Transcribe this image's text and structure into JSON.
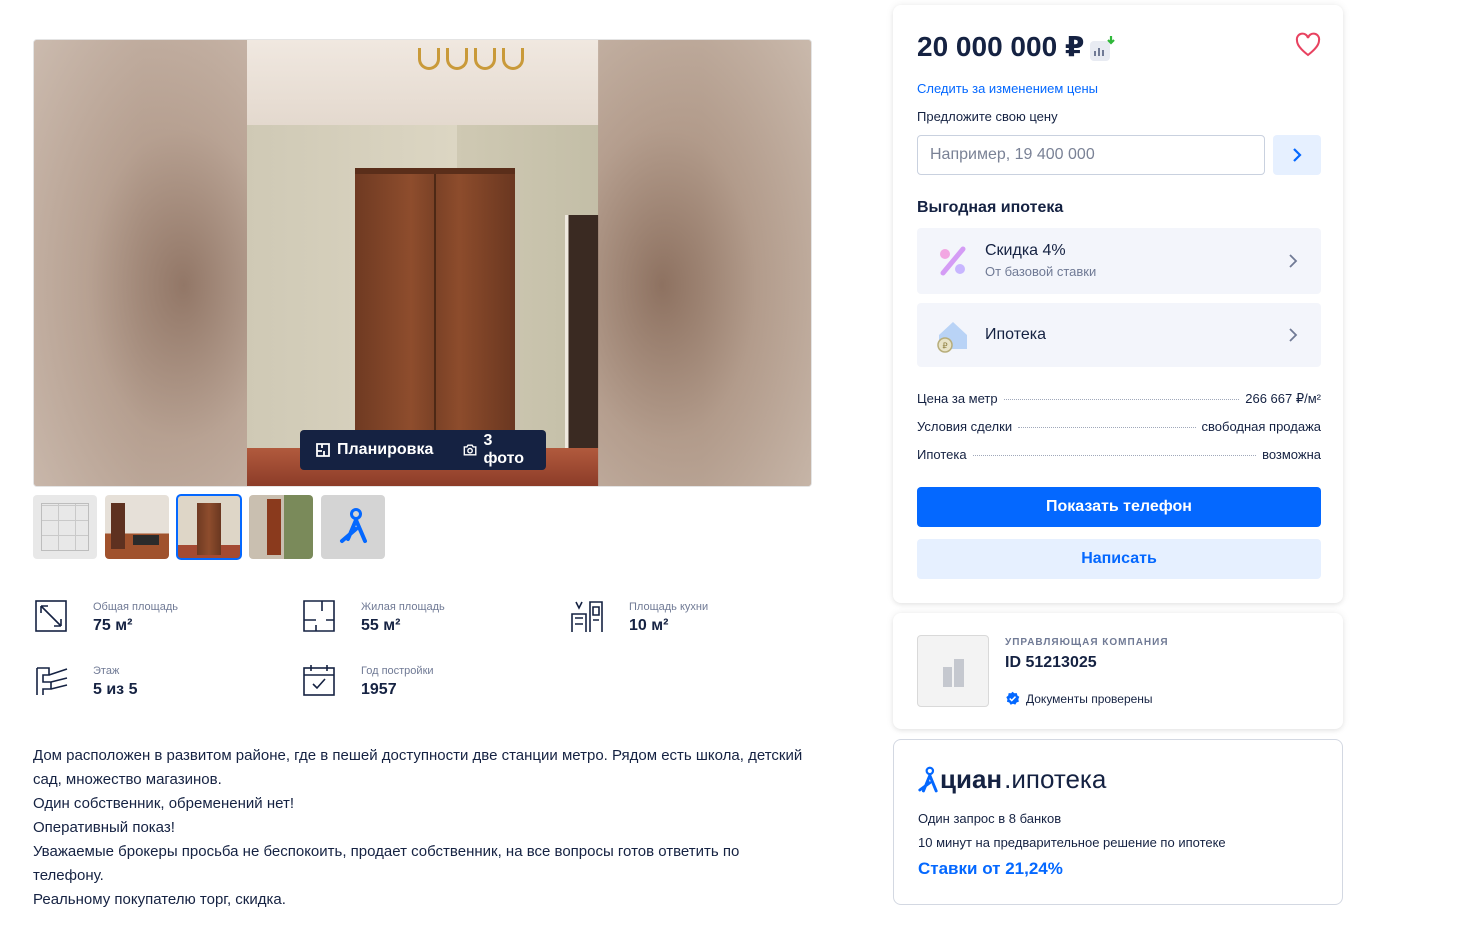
{
  "gallery": {
    "plan_label": "Планировка",
    "photos_label": "3 фото",
    "thumbnails": [
      {
        "kind": "layout-plan"
      },
      {
        "kind": "photo"
      },
      {
        "kind": "photo",
        "active": true
      },
      {
        "kind": "photo"
      },
      {
        "kind": "map"
      }
    ]
  },
  "features": [
    {
      "label": "Общая площадь",
      "value": "75 м²",
      "icon": "total-area-icon"
    },
    {
      "label": "Жилая площадь",
      "value": "55 м²",
      "icon": "living-area-icon"
    },
    {
      "label": "Площадь кухни",
      "value": "10 м²",
      "icon": "kitchen-area-icon"
    },
    {
      "label": "Этаж",
      "value": "5 из 5",
      "icon": "floor-stairs-icon"
    },
    {
      "label": "Год постройки",
      "value": "1957",
      "icon": "calendar-icon"
    }
  ],
  "description": [
    "Дом расположен в развитом районе, где в пешей доступности две станции метро. Рядом есть школа, детский сад, множество магазинов.",
    "Один собственник, обременений нет!",
    "Оперативный показ!",
    "Уважаемые брокеры просьба не беспокоить, продает собственник, на все вопросы готов ответить по телефону.",
    "Реальному покупателю торг, скидка."
  ],
  "price_card": {
    "price": "20 000 000 ₽",
    "follow_link": "Следить за изменением цены",
    "offer_label": "Предложите свою цену",
    "offer_placeholder": "Например, 19 400 000",
    "offer_value": "",
    "mortgage_title": "Выгодная ипотека",
    "discount_title": "Скидка 4%",
    "discount_sub": "От базовой ставки",
    "mortgage_item": "Ипотека",
    "facts": [
      {
        "label": "Цена за метр",
        "value": "266 667 ₽/м²"
      },
      {
        "label": "Условия сделки",
        "value": "свободная продажа"
      },
      {
        "label": "Ипотека",
        "value": "возможна"
      }
    ],
    "show_phone": "Показать телефон",
    "write": "Написать"
  },
  "company": {
    "kind": "Управляющая компания",
    "id": "ID 51213025",
    "verified": "Документы проверены"
  },
  "cian_mortgage": {
    "brand": "циан",
    "product": ".ипотека",
    "line1": "Один запрос в 8 банков",
    "line2": "10 минут на предварительное решение по ипотеке",
    "rate": "Ставки от 21,24%"
  },
  "colors": {
    "accent": "#0468ff",
    "accent_light": "#e6f0ff",
    "text": "#152242",
    "muted": "#707a95",
    "favorite": "#e84260",
    "price_down": "#2fb83a"
  }
}
